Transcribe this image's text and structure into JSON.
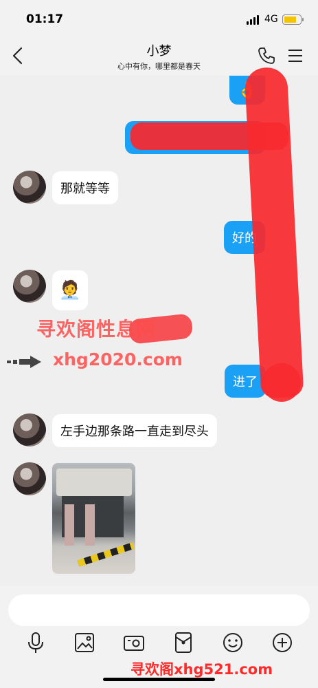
{
  "status_bar": {
    "time": "01:17",
    "network": "4G",
    "battery_level": 0.75
  },
  "nav": {
    "title": "小梦",
    "subtitle": "心中有你，哪里都是春天"
  },
  "messages": [
    {
      "from": "me",
      "type": "emoji",
      "content": "👌"
    },
    {
      "from": "me",
      "type": "text",
      "content": ""
    },
    {
      "from": "contact",
      "type": "text",
      "content": "那就等等"
    },
    {
      "from": "me",
      "type": "text",
      "content": "好的"
    },
    {
      "from": "contact",
      "type": "emoji",
      "content": "🧑‍💼"
    },
    {
      "from": "me",
      "type": "text",
      "content": "进了"
    },
    {
      "from": "contact",
      "type": "text",
      "content": "左手边那条路一直走到尽头"
    },
    {
      "from": "contact",
      "type": "image",
      "content": "photo of building entrance"
    }
  ],
  "watermarks": {
    "line1": "寻欢阁性息网",
    "line2": "xhg2020.com",
    "bottom": "寻欢阁xhg521.com"
  },
  "input": {
    "placeholder": ""
  },
  "toolbar": [
    "microphone-icon",
    "image-icon",
    "camera-icon",
    "red-packet-icon",
    "emoji-icon",
    "plus-icon"
  ],
  "colors": {
    "bubble_out": "#1aa0f5",
    "bubble_in": "#ffffff",
    "redaction": "#f72a2f",
    "watermark": "#ff4b4b"
  }
}
